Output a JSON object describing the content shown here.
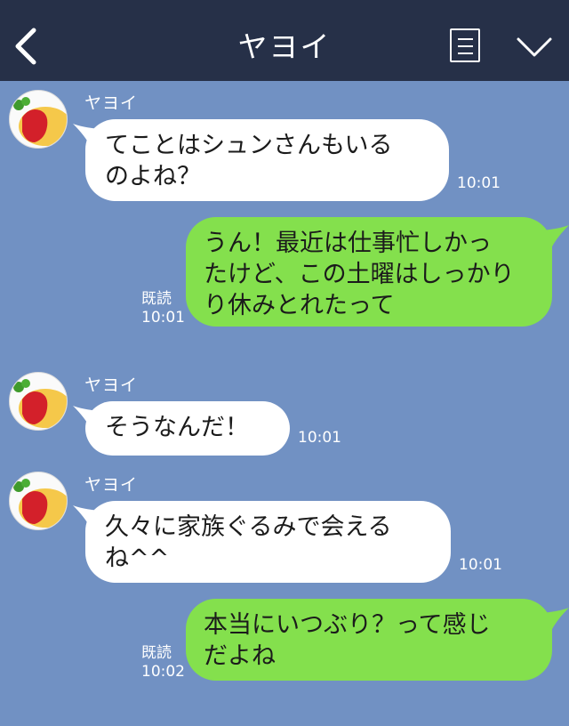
{
  "header": {
    "title": "ヤヨイ",
    "back_icon": "chevron-left-icon",
    "menu_icon": "list-icon",
    "dropdown_icon": "chevron-down-icon",
    "background": "#263048"
  },
  "chat": {
    "background": "#7191c3",
    "incoming_bubble_color": "#ffffff",
    "outgoing_bubble_color": "#84e04d",
    "messages": [
      {
        "direction": "incoming",
        "sender": "ヤヨイ",
        "lines": [
          "てことはシュンさんもいる",
          "のよね？"
        ],
        "time": "10:01"
      },
      {
        "direction": "outgoing",
        "lines": [
          "うん！最近は仕事忙しかっ",
          "たけど、この土曜はしっかり",
          "り休みとれたって"
        ],
        "read": "既読",
        "time": "10:01"
      },
      {
        "direction": "incoming",
        "sender": "ヤヨイ",
        "lines": [
          "そうなんだ！"
        ],
        "time": "10:01"
      },
      {
        "direction": "incoming",
        "sender": "ヤヨイ",
        "lines": [
          "久々に家族ぐるみで会える",
          "ね^^"
        ],
        "time": "10:01"
      },
      {
        "direction": "outgoing",
        "lines": [
          "本当にいつぶり？って感じ",
          "だよね"
        ],
        "read": "既読",
        "time": "10:02"
      }
    ]
  }
}
